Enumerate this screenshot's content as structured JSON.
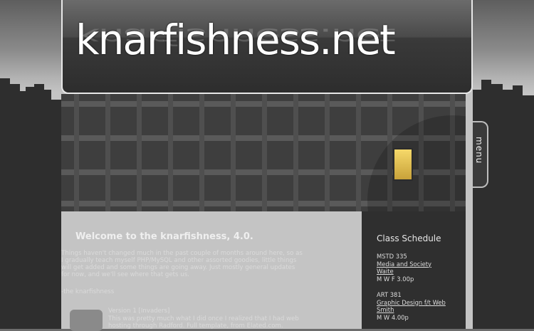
{
  "site": {
    "logo_text": "knarfishness.net"
  },
  "menu": {
    "label": "menu"
  },
  "main": {
    "heading": "Welcome to the knarfishness, 4.0.",
    "intro": "Things haven't changed much in the past couple of months around here, so as I gradually teach myself PHP/MySQL and other assorted goodies, little things will get added and some things are going away. Just mostly general updates for now, and we'll see where that gets us.",
    "signature": "-the knarfishness",
    "post": {
      "title": "Version 1 [Invaders]",
      "text": "This was pretty much what I did once I realized that I had web hosting through Radford. Full template, from Elated.com."
    }
  },
  "sidebar": {
    "heading": "Class Schedule",
    "classes": [
      {
        "code": "MSTD 335",
        "course": "Media and Society",
        "instructor": "Waite",
        "time": "M W F 3.00p"
      },
      {
        "code": "ART 381",
        "course": "Graphic Design f/t Web",
        "instructor": "Smith",
        "time": "M W 4.00p"
      }
    ]
  }
}
